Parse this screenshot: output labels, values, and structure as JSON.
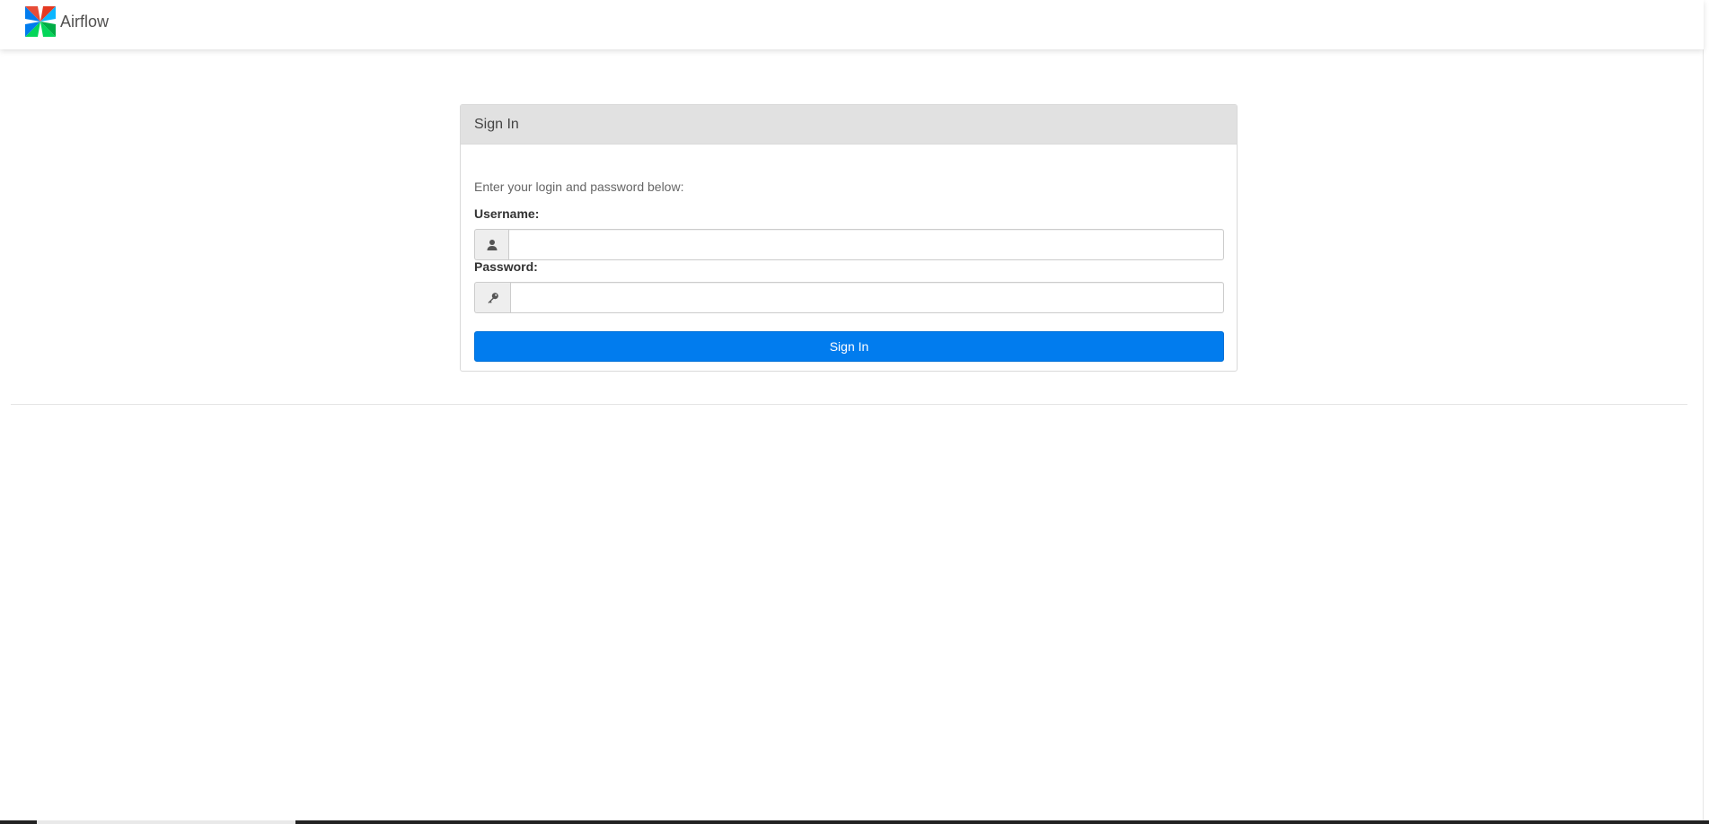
{
  "navbar": {
    "brand_text": "Airflow",
    "brand_icon": "airflow-pinwheel-logo"
  },
  "login": {
    "panel_title": "Sign In",
    "instructions": "Enter your login and password below:",
    "username_label": "Username:",
    "username_value": "",
    "username_icon": "user-icon",
    "password_label": "Password:",
    "password_value": "",
    "password_icon": "key-icon",
    "submit_label": "Sign In"
  },
  "colors": {
    "accent": "#017cee",
    "panel_heading_bg": "#e1e1e1",
    "logo_red": "#e43921",
    "logo_blue": "#0cb6ff",
    "logo_green": "#00ad46",
    "logo_teal": "#04d659",
    "logo_navy": "#017cee"
  }
}
